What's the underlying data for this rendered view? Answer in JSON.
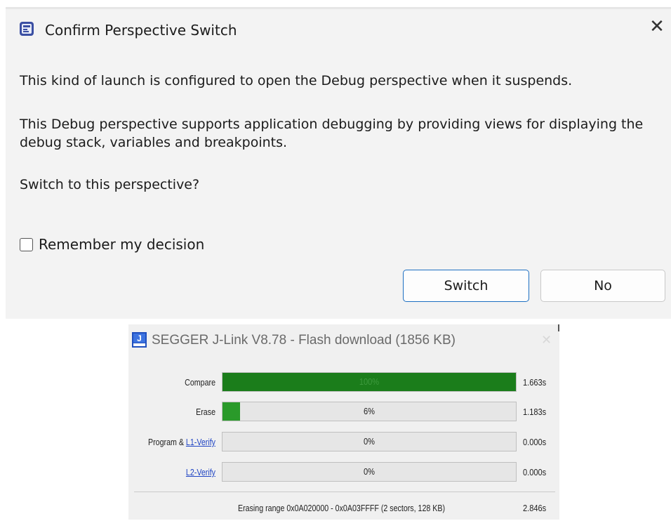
{
  "confirm_dialog": {
    "title": "Confirm Perspective Switch",
    "close_glyph": "✕",
    "message_1": "This kind of launch is configured to open the Debug perspective when it suspends.",
    "message_2": "This Debug perspective supports application debugging by providing views for displaying the debug stack, variables and breakpoints.",
    "question": "Switch to this perspective?",
    "remember_label": "Remember my decision",
    "remember_checked": false,
    "switch_label": "Switch",
    "no_label": "No",
    "icon": "eclipse-app-icon"
  },
  "jlink_window": {
    "title": "SEGGER J-Link V8.78 - Flash download (1856 KB)",
    "close_glyph": "✕",
    "icon": "segger-jlink-icon",
    "rows": [
      {
        "label": "Compare",
        "percent_text": "100%",
        "progress": 1.0,
        "time": "1.663s"
      },
      {
        "label": "Erase",
        "percent_text": "6%",
        "progress": 0.06,
        "time": "1.183s"
      },
      {
        "label_prefix": "Program & ",
        "label_link": "L1-Verify",
        "percent_text": "0%",
        "progress": 0.0,
        "time": "0.000s"
      },
      {
        "label_link": "L2-Verify",
        "percent_text": "0%",
        "progress": 0.0,
        "time": "0.000s"
      }
    ],
    "status_text": "Erasing range 0x0A020000 - 0x0A03FFFF (2 sectors, 128 KB)",
    "status_time": "2.846s"
  },
  "colors": {
    "dialog_bg": "#f3f3f3",
    "switch_border": "#1d6fc2",
    "progress_green": "#1b7d1b",
    "link_blue": "#1f44c4"
  }
}
